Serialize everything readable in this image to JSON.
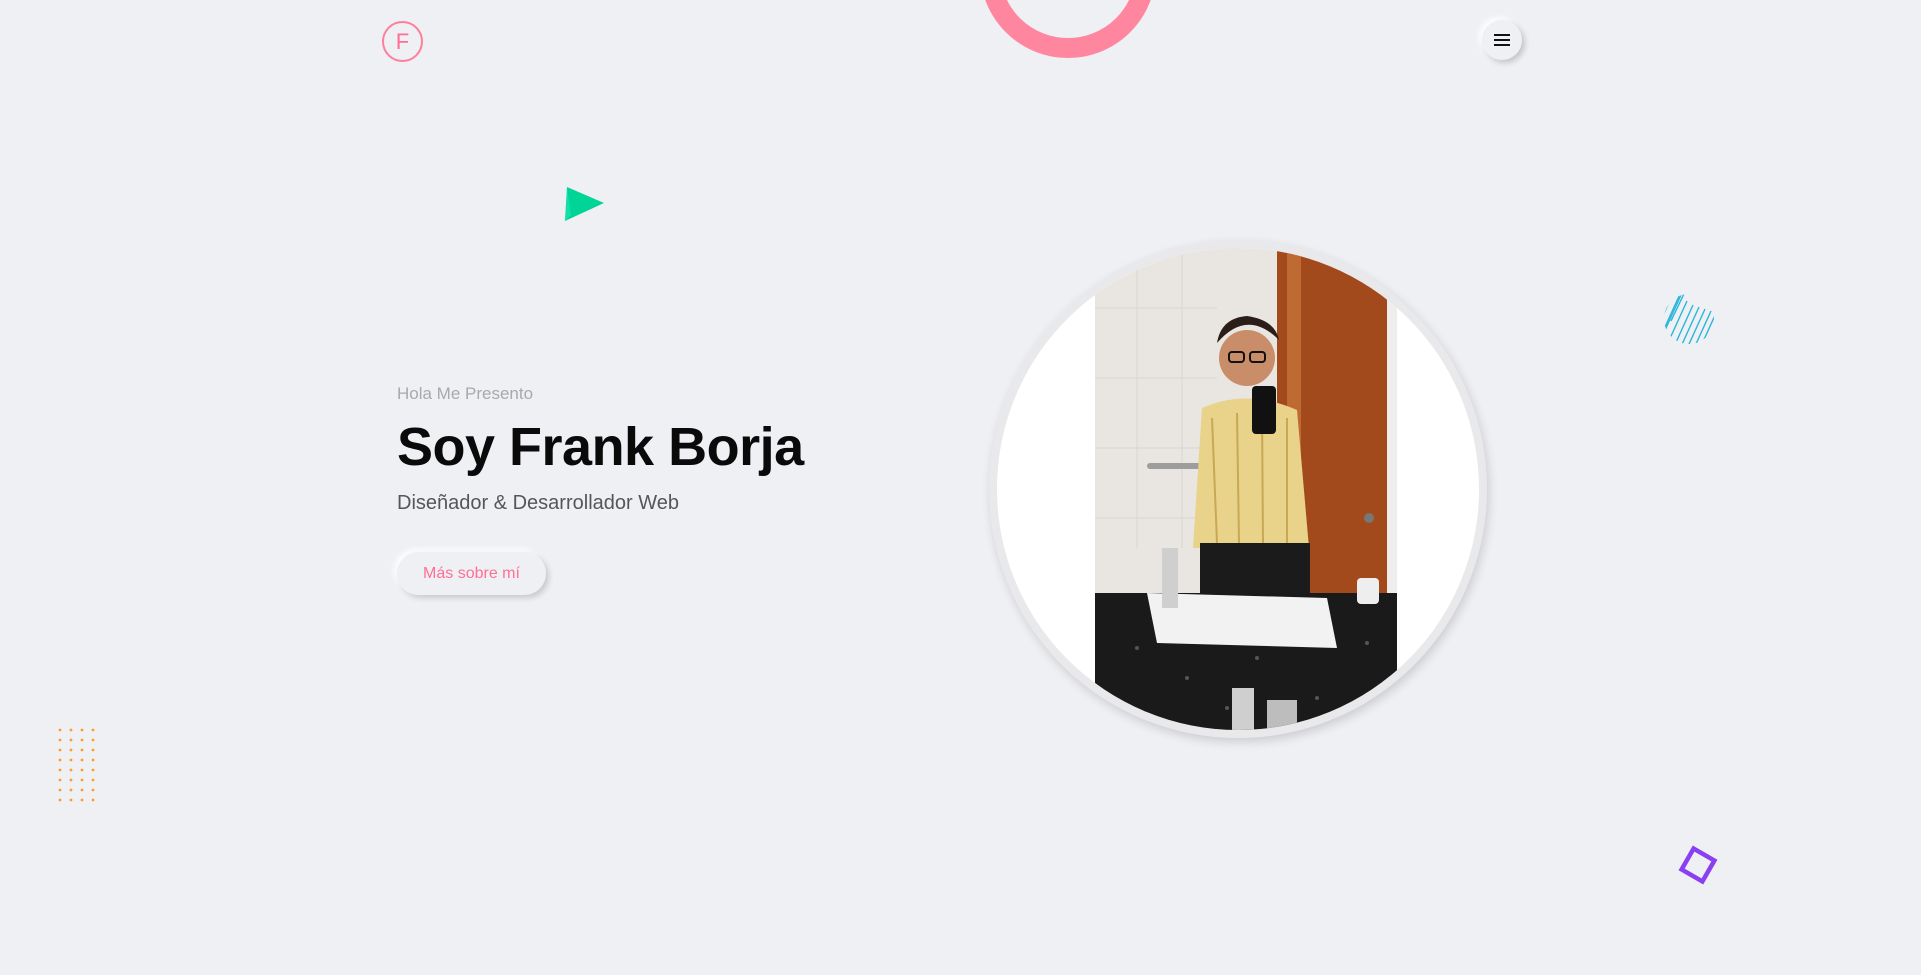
{
  "header": {
    "logo_letter": "F",
    "menu_icon": "hamburger-icon"
  },
  "hero": {
    "greeting": "Hola Me Presento",
    "name": "Soy Frank Borja",
    "role": "Diseñador & Desarrollador Web",
    "cta_label": "Más sobre mí"
  },
  "decorations": {
    "ring_color": "#ff869f",
    "triangle_color": "#00d497",
    "stripes_color": "#29b6d9",
    "dots_color": "#ff9a2e",
    "diamond_color": "#8b3ff2"
  },
  "colors": {
    "accent": "#ff6f93",
    "background": "#eff0f4"
  }
}
